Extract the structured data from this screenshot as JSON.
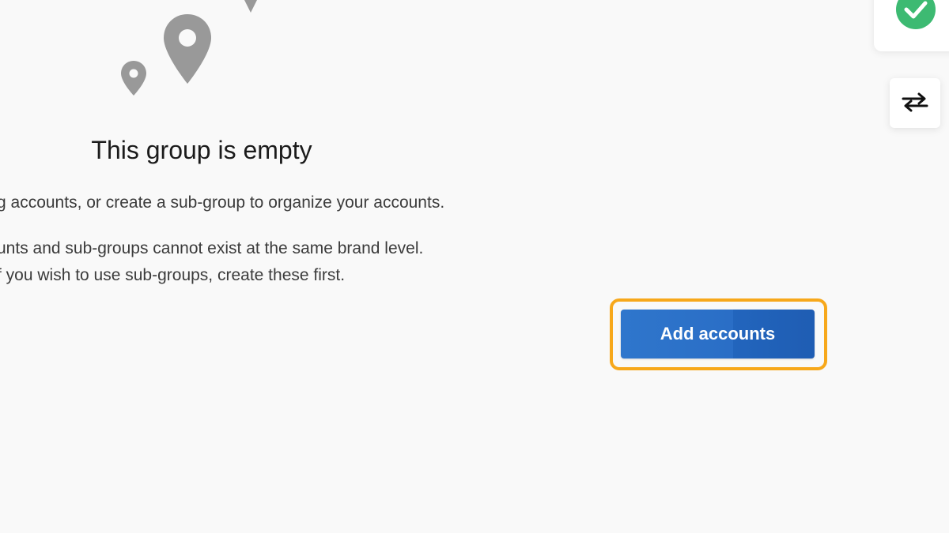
{
  "empty_state": {
    "title": "This group is empty",
    "line1": "g accounts, or create a sub-group to organize your accounts.",
    "line2": "unts and sub-groups cannot exist at the same brand level.",
    "line3": "f you wish to use sub-groups, create these first."
  },
  "actions": {
    "add_accounts_label": "Add accounts"
  },
  "icons": {
    "pins": [
      "map-pin-icon",
      "map-pin-icon",
      "map-pin-icon"
    ],
    "status": "check-circle-icon",
    "swap": "swap-arrows-icon"
  },
  "colors": {
    "background": "#f9f9f9",
    "pin_gray": "#999999",
    "primary_button": "#2a6ec6",
    "focus_ring": "#f7a81b",
    "success_green": "#3dba72"
  }
}
